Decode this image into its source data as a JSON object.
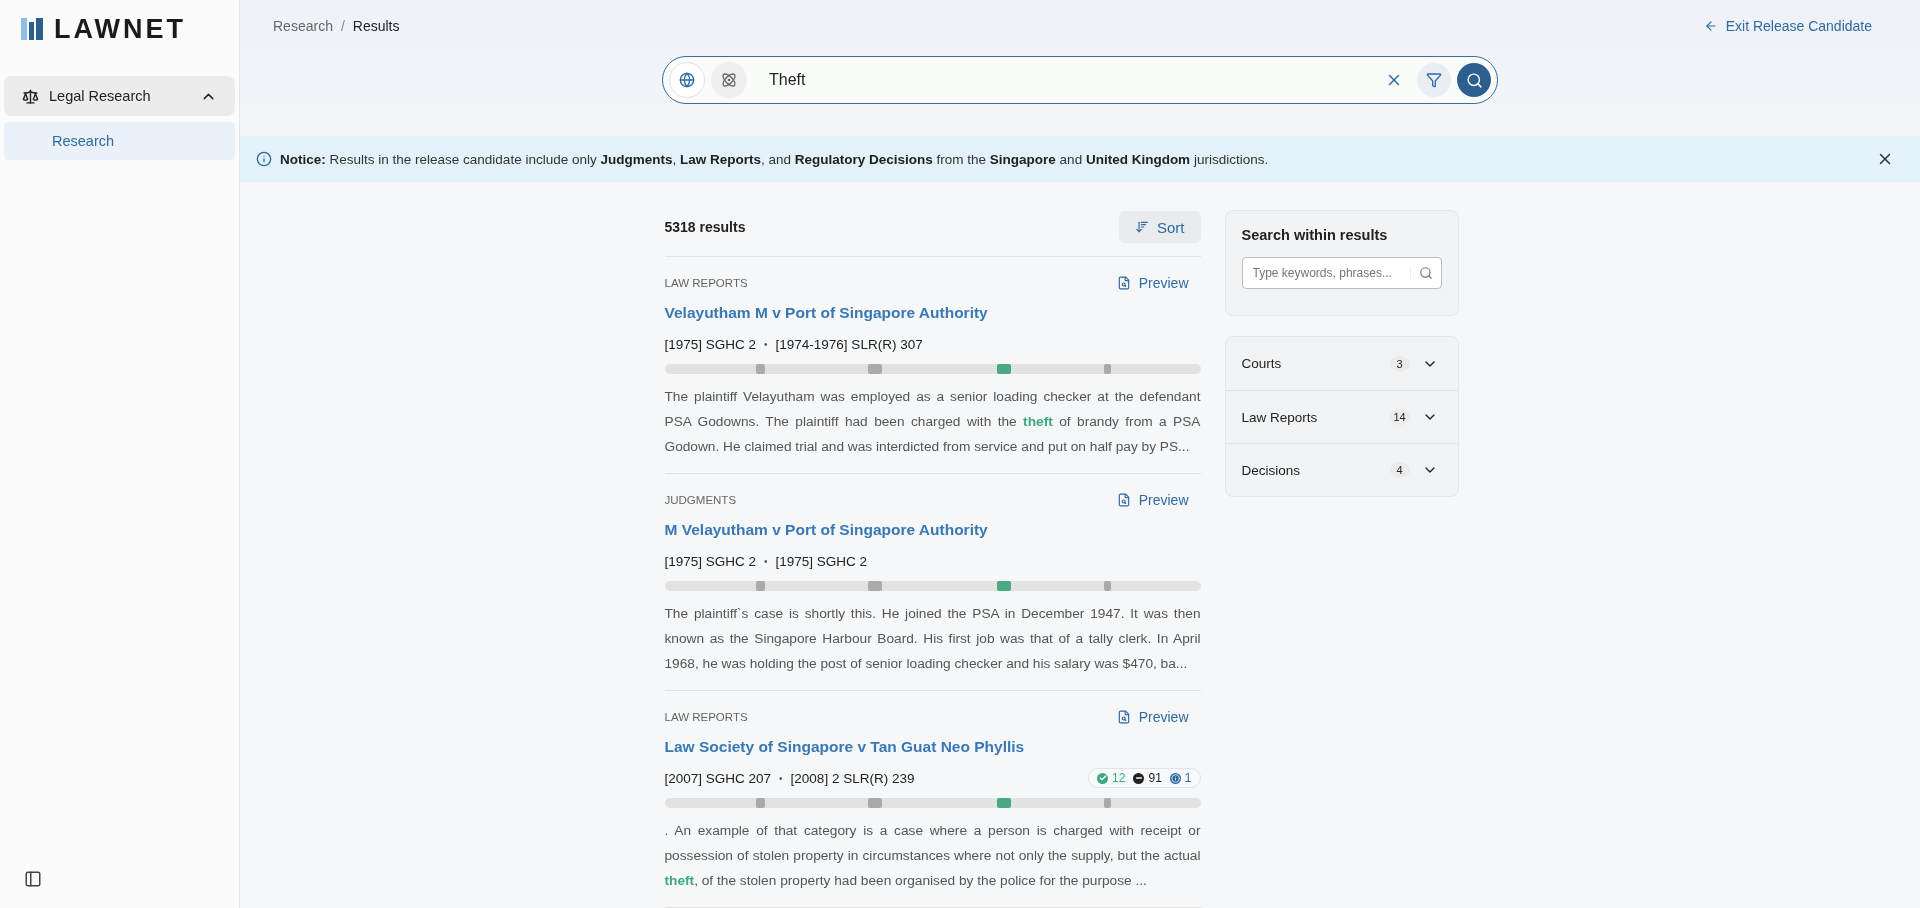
{
  "sidebar": {
    "logo": "LAWNET",
    "groups": [
      {
        "label": "Legal Research",
        "expanded": true,
        "children": [
          {
            "label": "Research",
            "selected": true
          }
        ]
      }
    ]
  },
  "breadcrumb": [
    "Research",
    "Results"
  ],
  "breadcrumb_separator": "/",
  "citation_separator": "•",
  "exit_link": "Exit Release Candidate",
  "search": {
    "modes": [
      {
        "kind": "globe",
        "selected": true
      },
      {
        "kind": "atom",
        "selected": false
      }
    ],
    "value": "Theft"
  },
  "notice": {
    "text": "**Notice:** Results in the release candidate include only **Judgments**, **Law Reports**, and **Regulatory Decisions** from the **Singapore** and **United Kingdom** jurisdictions."
  },
  "results_count": "5318 results",
  "sort_button": "Sort",
  "results": [
    {
      "category": "LAW REPORTS",
      "preview": "Preview",
      "title": "Velayutham M v Port of Singapore Authority",
      "citations": [
        "[1975] SGHC 2",
        "[1974-1976] SLR(R) 307"
      ],
      "snippet": "The plaintiff Velayutham was employed as a senior loading checker at the defendant PSA Godowns. The plaintiff had been charged with the **theft** of brandy from a PSA Godown. He claimed trial and was interdicted from service and put on half pay by PS..."
    },
    {
      "category": "JUDGMENTS",
      "preview": "Preview",
      "title": "M Velayutham v Port of Singapore Authority",
      "citations": [
        "[1975] SGHC 2",
        "[1975] SGHC 2"
      ],
      "snippet": "The plaintiff`s case is shortly this. He joined the PSA in December 1947. It was then known as the Singapore Harbour Board. His first job was that of a tally clerk. In April 1968, he was holding the post of senior loading checker and his salary was $470, ba..."
    },
    {
      "category": "LAW REPORTS",
      "preview": "Preview",
      "title": "Law Society of Singapore v Tan Guat Neo Phyllis",
      "citations": [
        "[2007] SGHC 207",
        "[2008] 2 SLR(R) 239"
      ],
      "treatments": [
        {
          "kind": "positive",
          "count": "12",
          "color": "#3aa981"
        },
        {
          "kind": "neutral",
          "count": "91",
          "color": "#222222"
        },
        {
          "kind": "info",
          "count": "1",
          "color": "#2f6aa3"
        }
      ],
      "snippet": ". An example of that category is a case where a person is charged with receipt or possession of stolen property in circumstances where not only the supply, but the actual **theft**, of the stolen property had been organised by the police for the purpose ..."
    }
  ],
  "within": {
    "title": "Search within results",
    "placeholder": "Type keywords, phrases..."
  },
  "facets": [
    {
      "label": "Courts",
      "count": "3",
      "expanded": false
    },
    {
      "label": "Law Reports",
      "count": "14",
      "expanded": false
    },
    {
      "label": "Decisions",
      "count": "4",
      "expanded": false
    }
  ]
}
